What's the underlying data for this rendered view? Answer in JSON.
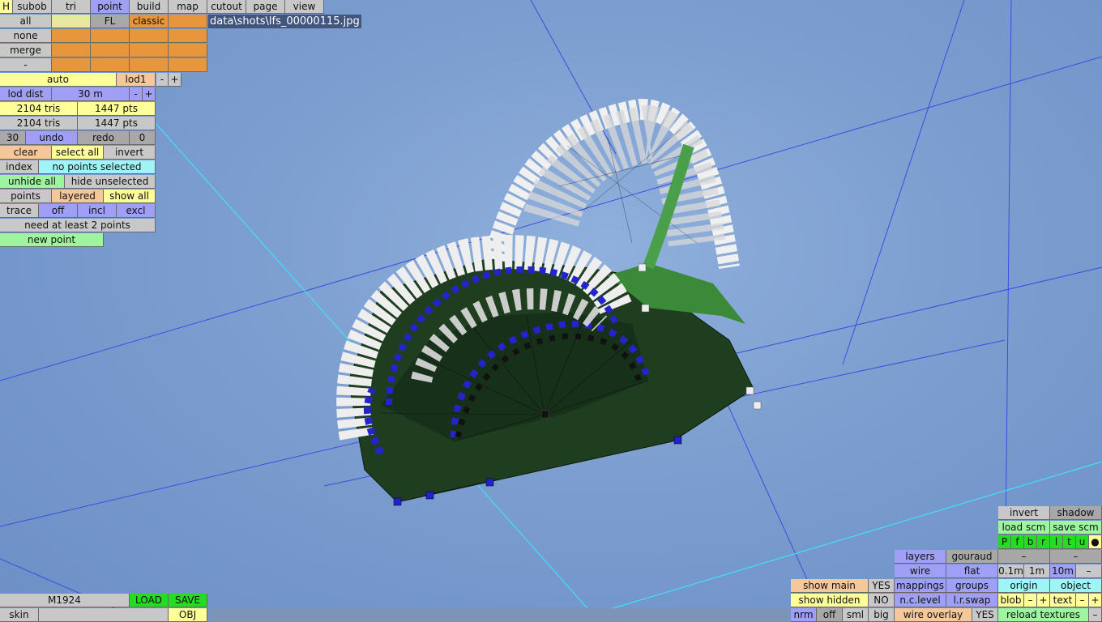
{
  "path": "data\\shots\\lfs_00000115.jpg",
  "tabs": [
    "H",
    "subob",
    "tri",
    "point",
    "build",
    "map",
    "cutout",
    "page",
    "view"
  ],
  "select": {
    "all": "all",
    "fl": "FL",
    "classic": "classic",
    "none": "none",
    "merge": "merge",
    "minus": "-"
  },
  "lod": {
    "auto": "auto",
    "lod1": "lod1",
    "minus": "-",
    "plus": "+",
    "dist_label": "lod dist",
    "dist_value": "30 m"
  },
  "stats": {
    "tris1": "2104 tris",
    "pts1": "1447 pts",
    "tris2": "2104 tris",
    "pts2": "1447 pts"
  },
  "history": {
    "count": "30",
    "undo": "undo",
    "redo": "redo",
    "zero": "0"
  },
  "sel": {
    "clear": "clear",
    "select_all": "select all",
    "invert": "invert"
  },
  "index": {
    "label": "index",
    "status": "no points selected"
  },
  "hide": {
    "unhide_all": "unhide all",
    "hide_unselected": "hide unselected"
  },
  "view_mode": {
    "points": "points",
    "layered": "layered",
    "show_all": "show all"
  },
  "trace": {
    "label": "trace",
    "off": "off",
    "incl": "incl",
    "excl": "excl"
  },
  "need_points": "need at least 2 points",
  "new_point": "new point",
  "file": {
    "name": "M1924",
    "load": "LOAD",
    "save": "SAVE",
    "skin": "skin",
    "obj": "OBJ"
  },
  "display": {
    "show_main": "show main",
    "yes1": "YES",
    "show_hidden": "show hidden",
    "no": "NO",
    "nrm": "nrm",
    "off": "off",
    "sml": "sml",
    "big": "big"
  },
  "render": {
    "layers": "layers",
    "gouraud": "gouraud",
    "wire": "wire",
    "flat": "flat",
    "mappings": "mappings",
    "groups": "groups",
    "nc_level": "n.c.level",
    "lr_swap": "l.r.swap",
    "wire_overlay": "wire overlay",
    "yes2": "YES"
  },
  "right": {
    "invert": "invert",
    "shadow": "shadow",
    "load_scm": "load scm",
    "save_scm": "save scm",
    "p": "P",
    "f": "f",
    "b": "b",
    "r": "r",
    "l": "l",
    "t": "t",
    "u": "u",
    "dot": "●",
    "m1": "–",
    "m2": "–",
    "g01": "0.1m",
    "g1": "1m",
    "g10": "10m",
    "gm": "–",
    "origin": "origin",
    "object": "object",
    "blob": "blob",
    "bm": "–",
    "bp": "+",
    "text": "text",
    "tm": "–",
    "tp": "+",
    "reload": "reload textures",
    "rm": "–"
  },
  "colors": {
    "sky": "#7b9dcf",
    "mesh": "#1f3d1f",
    "selected": "#2222cc",
    "point": "#eeeeee"
  }
}
